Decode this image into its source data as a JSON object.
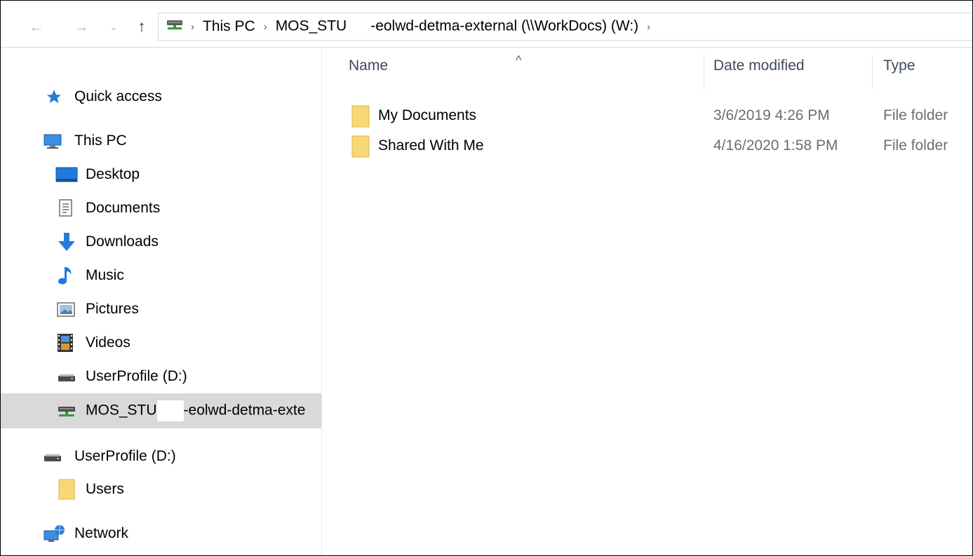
{
  "navigation": {
    "back_glyph": "←",
    "forward_glyph": "→",
    "recent_glyph": "⌄",
    "up_glyph": "↑",
    "breadcrumb": [
      "This PC",
      "MOS_STU",
      "-eolwd-detma-external (\\\\WorkDocs) (W:)"
    ],
    "separator": "›"
  },
  "sidebar": {
    "items": [
      {
        "label": "Quick access",
        "icon": "star-icon"
      },
      {
        "label": "This PC",
        "icon": "computer-icon"
      },
      {
        "label": "Desktop",
        "icon": "desktop-icon"
      },
      {
        "label": "Documents",
        "icon": "documents-icon"
      },
      {
        "label": "Downloads",
        "icon": "download-arrow-icon"
      },
      {
        "label": "Music",
        "icon": "music-note-icon"
      },
      {
        "label": "Pictures",
        "icon": "pictures-icon"
      },
      {
        "label": "Videos",
        "icon": "film-icon"
      },
      {
        "label": "UserProfile (D:)",
        "icon": "drive-icon"
      },
      {
        "label_a": "MOS_STU",
        "label_b": "-eolwd-detma-exte",
        "icon": "network-drive-icon",
        "selected": true
      },
      {
        "label": "UserProfile (D:)",
        "icon": "drive-icon"
      },
      {
        "label": "Users",
        "icon": "folder-icon"
      },
      {
        "label": "Network",
        "icon": "network-icon"
      }
    ]
  },
  "file_list": {
    "columns": {
      "name": "Name",
      "date": "Date modified",
      "type": "Type"
    },
    "sort_glyph": "^",
    "rows": [
      {
        "name": "My Documents",
        "date": "3/6/2019 4:26 PM",
        "type": "File folder"
      },
      {
        "name": "Shared With Me",
        "date": "4/16/2020 1:58 PM",
        "type": "File folder"
      }
    ]
  },
  "colors": {
    "selected_bg": "#d9d9d9",
    "folder_yellow": "#f8d775",
    "header_text": "#3e4a5c",
    "meta_text": "#6d6d6d"
  }
}
